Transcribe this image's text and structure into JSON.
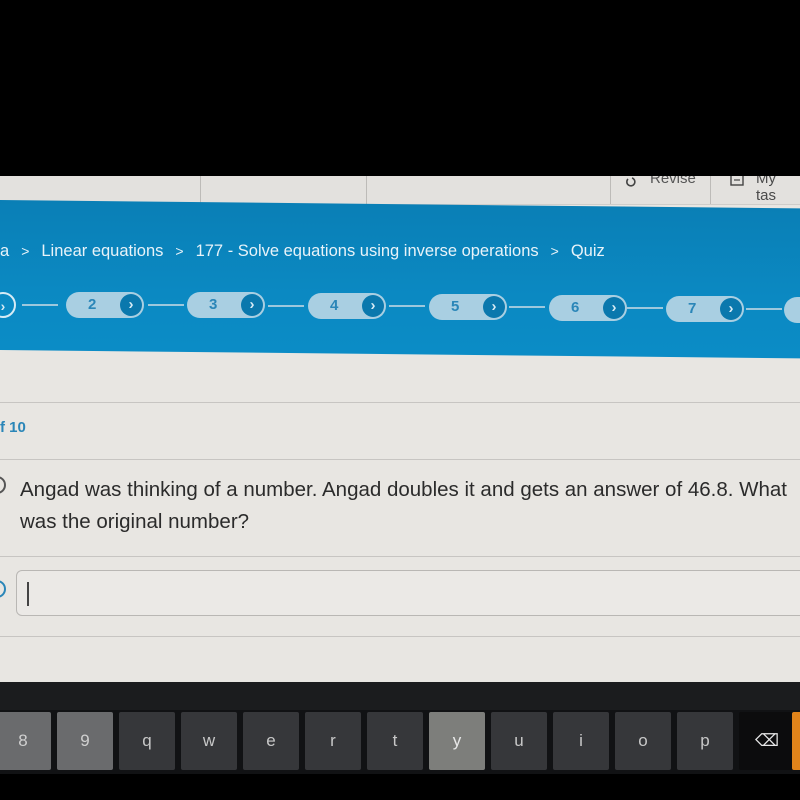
{
  "topnav": {
    "items": [
      {
        "label": "Revise",
        "icon": "revise-icon"
      },
      {
        "label": "My tas",
        "icon": "tasks-icon"
      }
    ]
  },
  "breadcrumb": {
    "items": [
      {
        "label": "a"
      },
      {
        "label": "Linear equations"
      },
      {
        "label": "177 - Solve equations using inverse operations"
      },
      {
        "label": "Quiz"
      }
    ],
    "separator": ">"
  },
  "quiz_steps": {
    "current_arrow": "›",
    "steps": [
      {
        "number": "2",
        "arrow": "›"
      },
      {
        "number": "3",
        "arrow": "›"
      },
      {
        "number": "4",
        "arrow": "›"
      },
      {
        "number": "5",
        "arrow": "›"
      },
      {
        "number": "6",
        "arrow": "›"
      },
      {
        "number": "7",
        "arrow": "›"
      }
    ]
  },
  "question": {
    "count_label": "f 10",
    "text": "Angad was thinking of a number. Angad doubles it and gets an answer of 46.8. What was the original number?"
  },
  "answer": {
    "value": "",
    "placeholder": ""
  },
  "keyboard": {
    "keys": [
      "8",
      "9",
      "q",
      "w",
      "e",
      "r",
      "t",
      "y",
      "u",
      "i",
      "o",
      "p"
    ],
    "highlighted_key": "y",
    "backspace_icon": "⌫"
  },
  "colors": {
    "header_blue": "#0b89c2",
    "accent_blue": "#2a86b8",
    "enter_key": "#e0831a"
  }
}
